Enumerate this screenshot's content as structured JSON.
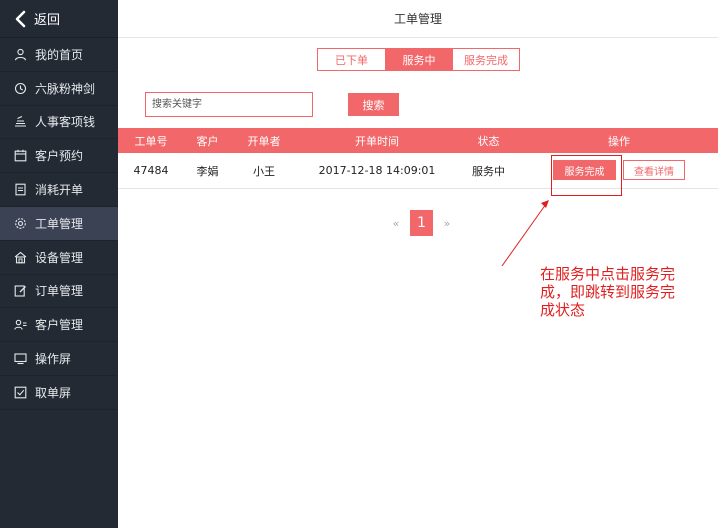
{
  "sidebar": {
    "back_label": "返回",
    "items": [
      {
        "label": "我的首页",
        "icon": "user-icon"
      },
      {
        "label": "六脉粉神剑",
        "icon": "clock-icon"
      },
      {
        "label": "人事客项钱",
        "icon": "coins-icon"
      },
      {
        "label": "客户预约",
        "icon": "calendar-icon"
      },
      {
        "label": "消耗开单",
        "icon": "receipt-icon"
      },
      {
        "label": "工单管理",
        "icon": "gear-icon",
        "active": true
      },
      {
        "label": "设备管理",
        "icon": "building-icon"
      },
      {
        "label": "订单管理",
        "icon": "edit-icon"
      },
      {
        "label": "客户管理",
        "icon": "users-icon"
      },
      {
        "label": "操作屏",
        "icon": "monitor-icon"
      },
      {
        "label": "取单屏",
        "icon": "checkbox-icon"
      }
    ]
  },
  "header": {
    "title": "工单管理"
  },
  "tabs": [
    {
      "label": "已下单"
    },
    {
      "label": "服务中",
      "active": true
    },
    {
      "label": "服务完成"
    }
  ],
  "search": {
    "placeholder": "搜索关键字",
    "button_label": "搜索"
  },
  "table": {
    "headers": [
      "工单号",
      "客户",
      "开单者",
      "开单时间",
      "状态",
      "操作"
    ],
    "rows": [
      {
        "id": "47484",
        "customer": "李娟",
        "operator": "小王",
        "time": "2017-12-18 14:09:01",
        "status": "服务中",
        "action_complete": "服务完成",
        "action_detail": "查看详情"
      }
    ]
  },
  "pagination": {
    "prev": "«",
    "current": "1",
    "next": "»"
  },
  "annotation": {
    "line1": "在服务中点击服务完",
    "line2": "成，即跳转到服务完",
    "line3": "成状态"
  },
  "colors": {
    "accent": "#f1676a",
    "sidebar_bg": "#232a34",
    "sidebar_active": "#3a4253",
    "annotation": "#e02020"
  }
}
